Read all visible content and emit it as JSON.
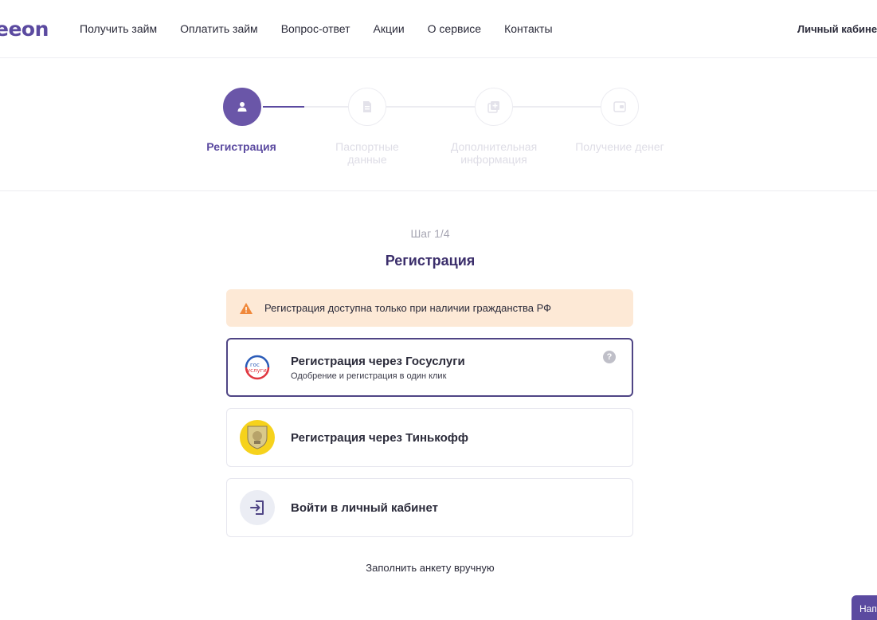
{
  "header": {
    "logo_suffix": "eeon",
    "nav": [
      "Получить займ",
      "Оплатить займ",
      "Вопрос-ответ",
      "Акции",
      "О сервисе",
      "Контакты"
    ],
    "cabinet": "Личный кабине"
  },
  "stepper": {
    "steps": [
      {
        "label": "Регистрация",
        "icon": "user-icon",
        "active": true
      },
      {
        "label": "Паспортные данные",
        "icon": "document-icon",
        "active": false
      },
      {
        "label": "Дополнительная информация",
        "icon": "add-info-icon",
        "active": false
      },
      {
        "label": "Получение денег",
        "icon": "wallet-icon",
        "active": false
      }
    ]
  },
  "main": {
    "step_counter": "Шаг 1/4",
    "title": "Регистрация",
    "warning": "Регистрация доступна только при наличии гражданства РФ",
    "options": [
      {
        "title": "Регистрация через Госуслуги",
        "subtitle": "Одобрение и регистрация в один клик",
        "icon": "gosuslugi-logo-icon"
      },
      {
        "title": "Регистрация через Тинькофф",
        "icon": "tinkoff-logo-icon"
      },
      {
        "title": "Войти в личный кабинет",
        "icon": "login-icon"
      }
    ],
    "gosuslugi_logo": [
      "гос",
      "услуги"
    ],
    "manual_link": "Заполнить анкету вручную"
  },
  "chat_button": "Нап",
  "colors": {
    "accent": "#5b4aa0",
    "warning_bg": "#fde9d6",
    "warning_icon": "#f0883a"
  }
}
